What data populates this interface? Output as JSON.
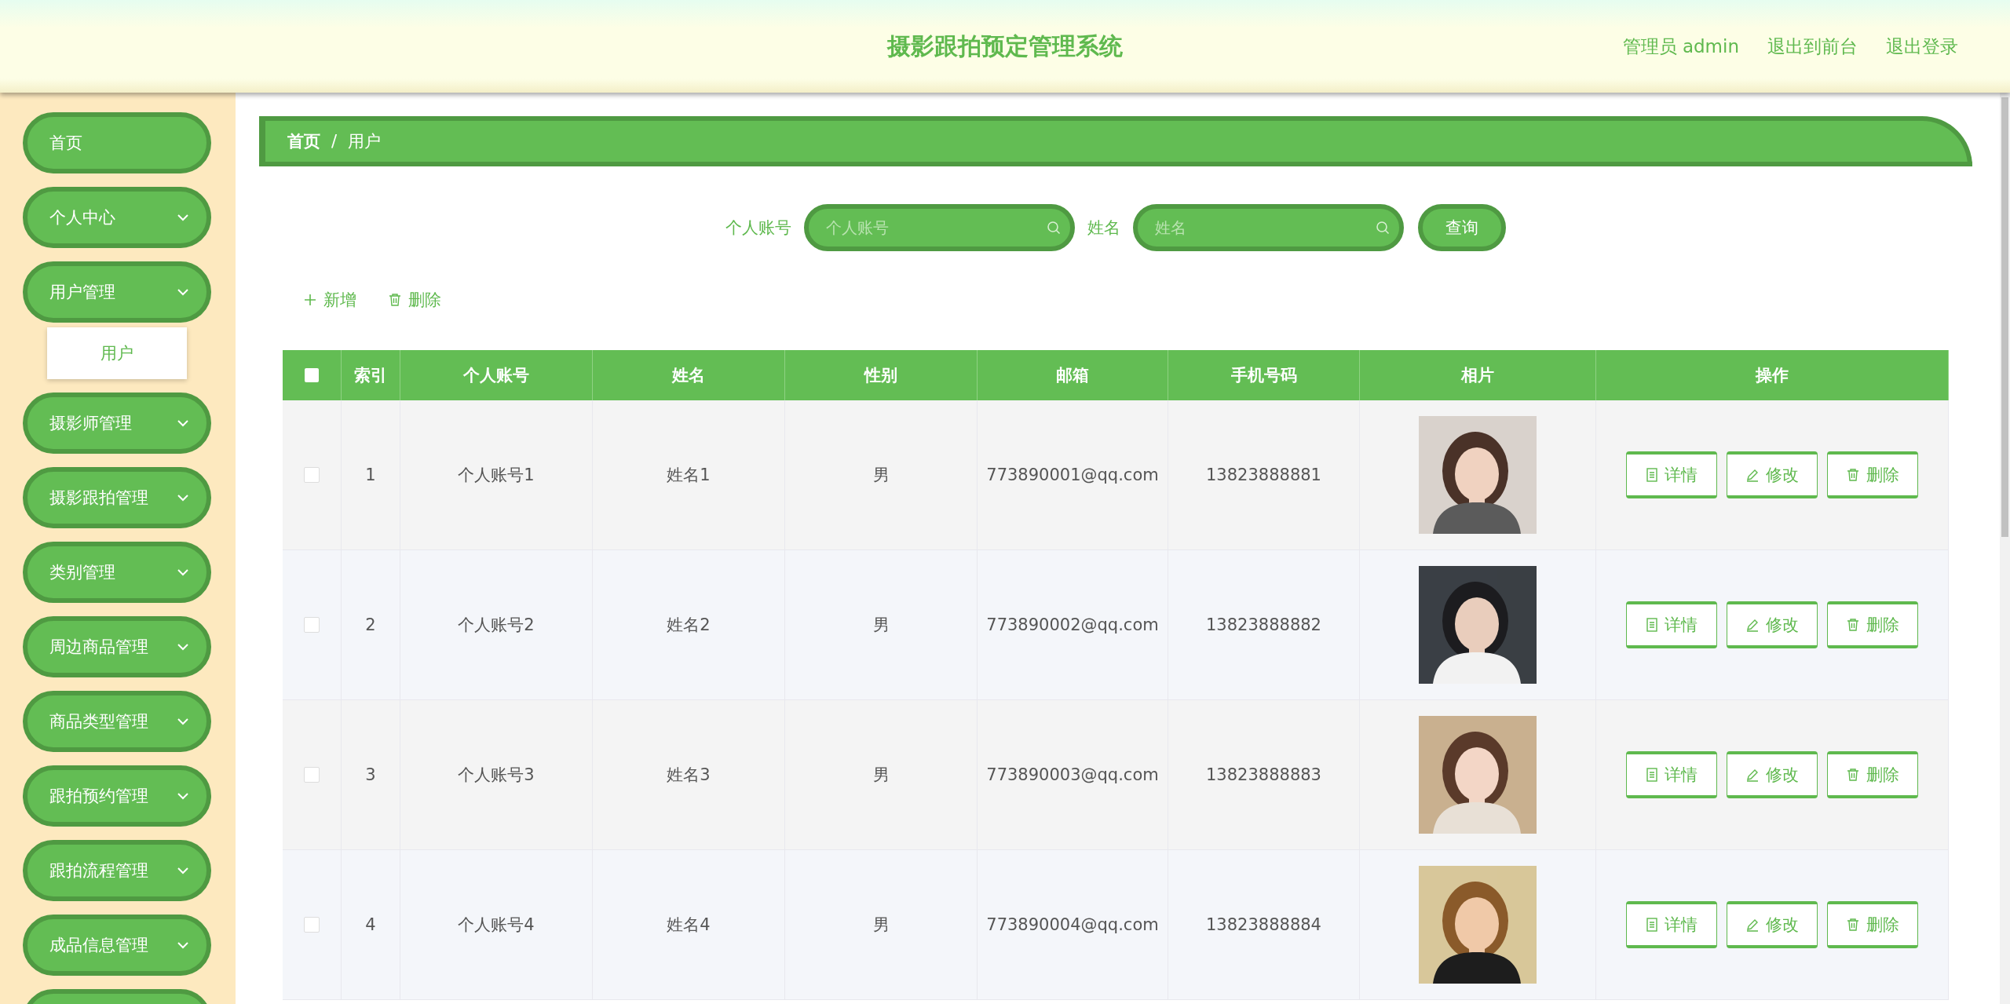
{
  "header": {
    "title": "摄影跟拍预定管理系统",
    "links": [
      "管理员 admin",
      "退出到前台",
      "退出登录"
    ]
  },
  "sidebar": {
    "items": [
      {
        "label": "首页",
        "kind": "link"
      },
      {
        "label": "个人中心",
        "kind": "group"
      },
      {
        "label": "用户管理",
        "kind": "group",
        "children": [
          {
            "label": "用户"
          }
        ]
      },
      {
        "label": "摄影师管理",
        "kind": "group"
      },
      {
        "label": "摄影跟拍管理",
        "kind": "group"
      },
      {
        "label": "类别管理",
        "kind": "group"
      },
      {
        "label": "周边商品管理",
        "kind": "group"
      },
      {
        "label": "商品类型管理",
        "kind": "group"
      },
      {
        "label": "跟拍预约管理",
        "kind": "group"
      },
      {
        "label": "跟拍流程管理",
        "kind": "group"
      },
      {
        "label": "成品信息管理",
        "kind": "group"
      }
    ]
  },
  "breadcrumb": {
    "items": [
      "首页",
      "用户"
    ],
    "separator": "/"
  },
  "search": {
    "fields": [
      {
        "label": "个人账号",
        "placeholder": "个人账号"
      },
      {
        "label": "姓名",
        "placeholder": "姓名"
      }
    ],
    "button": "查询"
  },
  "toolbar": [
    {
      "label": "新增",
      "kind": "add"
    },
    {
      "label": "删除",
      "kind": "delete"
    }
  ],
  "table": {
    "select_all": {
      "checked": false
    },
    "columns": [
      "索引",
      "个人账号",
      "姓名",
      "性别",
      "邮箱",
      "手机号码",
      "相片",
      "操作"
    ],
    "rows": [
      {
        "checked": false,
        "cells": [
          "1",
          "个人账号1",
          "姓名1",
          "男",
          "773890001@qq.com",
          "13823888881"
        ],
        "photo": {
          "kind": "picture"
        },
        "actions": [
          "详情",
          "修改",
          "删除"
        ]
      },
      {
        "checked": false,
        "cells": [
          "2",
          "个人账号2",
          "姓名2",
          "男",
          "773890002@qq.com",
          "13823888882"
        ],
        "photo": {
          "kind": "picture"
        },
        "actions": [
          "详情",
          "修改",
          "删除"
        ]
      },
      {
        "checked": false,
        "cells": [
          "3",
          "个人账号3",
          "姓名3",
          "男",
          "773890003@qq.com",
          "13823888883"
        ],
        "photo": {
          "kind": "picture"
        },
        "actions": [
          "详情",
          "修改",
          "删除"
        ]
      },
      {
        "checked": false,
        "cells": [
          "4",
          "个人账号4",
          "姓名4",
          "男",
          "773890004@qq.com",
          "13823888884"
        ],
        "photo": {
          "kind": "picture"
        },
        "actions": [
          "详情",
          "修改",
          "删除"
        ]
      }
    ]
  }
}
